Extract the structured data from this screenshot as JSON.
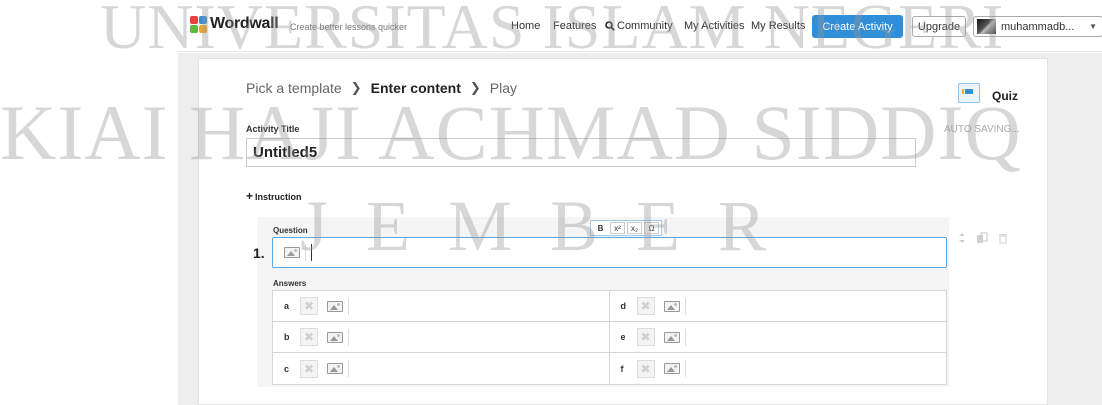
{
  "header": {
    "logo_text": "Wordwall",
    "tagline": "Create better lessons quicker",
    "nav": {
      "home": "Home",
      "features": "Features",
      "community": "Community",
      "my_activities": "My Activities",
      "my_results": "My Results"
    },
    "create_activity": "Create Activity",
    "upgrade": "Upgrade",
    "username": "muhammadb...",
    "logo_colors": [
      "#e9423c",
      "#2f8fd8",
      "#58b947",
      "#f5a623"
    ],
    "accent": "#2f8fd8"
  },
  "breadcrumb": {
    "step1": "Pick a template",
    "step2": "Enter content",
    "step3": "Play"
  },
  "template": {
    "name": "Quiz"
  },
  "activity": {
    "title_label": "Activity Title",
    "title_value": "Untitled5",
    "autosave": "AUTO SAVING..."
  },
  "instruction": {
    "label": "Instruction"
  },
  "question": {
    "number": "1.",
    "label": "Question",
    "toolbar": {
      "bold": "B",
      "superscript": "x²",
      "subscript": "x₂",
      "omega": "Ω"
    },
    "answers_label": "Answers",
    "answers": [
      {
        "letter": "a"
      },
      {
        "letter": "d"
      },
      {
        "letter": "b"
      },
      {
        "letter": "e"
      },
      {
        "letter": "c"
      },
      {
        "letter": "f"
      }
    ]
  },
  "watermark": {
    "line1": "UNIVERSITAS ISLAM NEGERI",
    "line2": "KIAI HAJI ACHMAD SIDDIQ",
    "line3": "JEMBER"
  }
}
